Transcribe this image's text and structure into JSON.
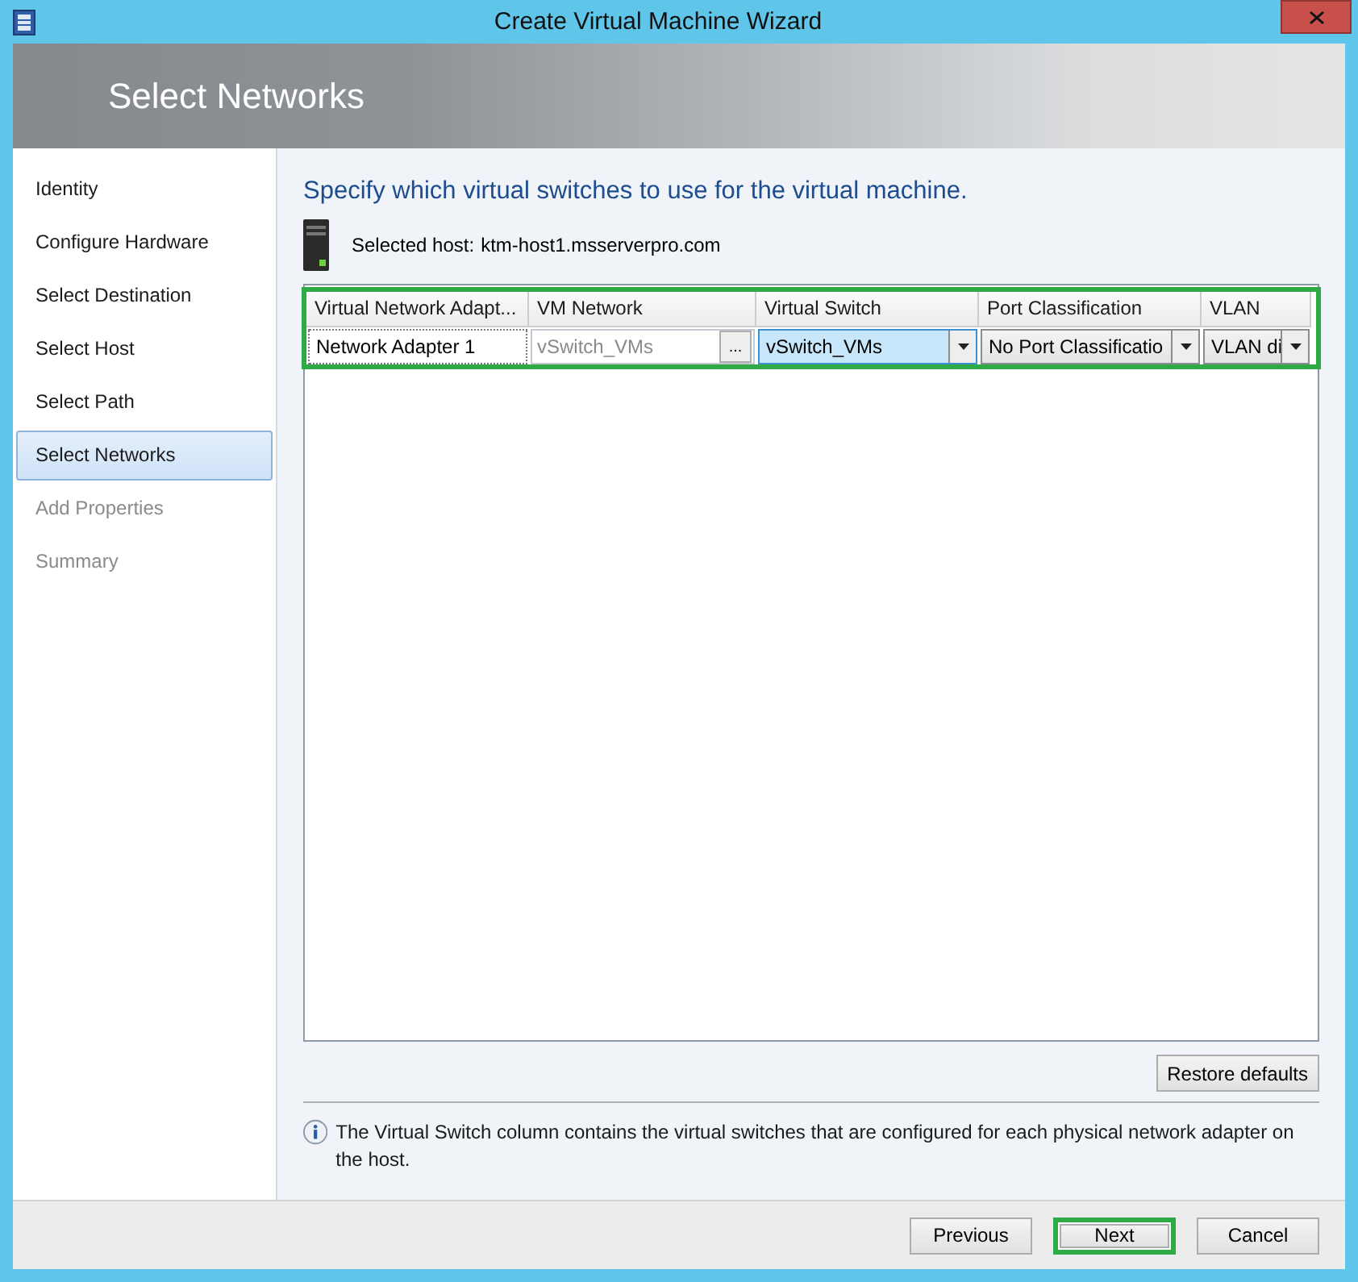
{
  "window": {
    "title": "Create Virtual Machine Wizard"
  },
  "header": {
    "title": "Select Networks"
  },
  "steps": [
    {
      "label": "Identity",
      "selected": false,
      "disabled": false
    },
    {
      "label": "Configure Hardware",
      "selected": false,
      "disabled": false
    },
    {
      "label": "Select Destination",
      "selected": false,
      "disabled": false
    },
    {
      "label": "Select Host",
      "selected": false,
      "disabled": false
    },
    {
      "label": "Select Path",
      "selected": false,
      "disabled": false
    },
    {
      "label": "Select Networks",
      "selected": true,
      "disabled": false
    },
    {
      "label": "Add Properties",
      "selected": false,
      "disabled": true
    },
    {
      "label": "Summary",
      "selected": false,
      "disabled": true
    }
  ],
  "instruction": "Specify which virtual switches to use for the virtual machine.",
  "host": {
    "label": "Selected host:",
    "value": "ktm-host1.msserverpro.com"
  },
  "table": {
    "highlighted": true,
    "columns": [
      "Virtual Network Adapt...",
      "VM Network",
      "Virtual Switch",
      "Port Classification",
      "VLAN"
    ],
    "rows": [
      {
        "cells": [
          {
            "kind": "text",
            "value": "Network Adapter 1"
          },
          {
            "kind": "browse",
            "value": "vSwitch_VMs",
            "disabled": true,
            "button": "..."
          },
          {
            "kind": "dropdown",
            "value": "vSwitch_VMs",
            "selected": true
          },
          {
            "kind": "dropdown",
            "value": "No Port Classificatio",
            "selected": false
          },
          {
            "kind": "dropdown",
            "value": "VLAN di",
            "selected": false
          }
        ]
      }
    ]
  },
  "restore_button": "Restore defaults",
  "info": "The Virtual Switch column contains the virtual switches that are configured for each physical network adapter on the host.",
  "buttons": [
    {
      "label": "Previous",
      "highlighted": false
    },
    {
      "label": "Next",
      "highlighted": true
    },
    {
      "label": "Cancel",
      "highlighted": false
    }
  ]
}
